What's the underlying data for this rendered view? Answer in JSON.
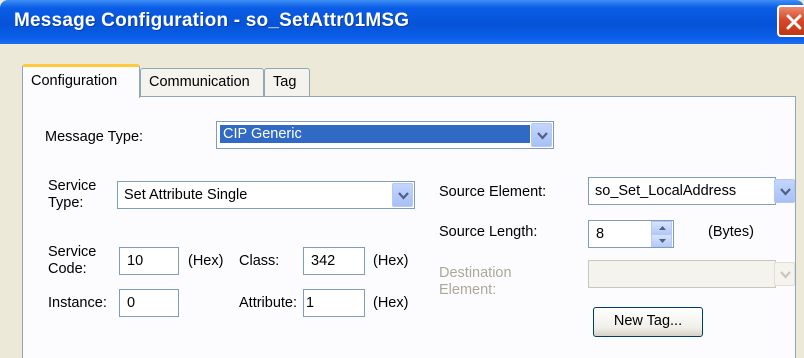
{
  "window": {
    "title": "Message Configuration - so_SetAttr01MSG"
  },
  "tabs": [
    {
      "label": "Configuration"
    },
    {
      "label": "Communication"
    },
    {
      "label": "Tag"
    }
  ],
  "form": {
    "message_type_label": "Message Type:",
    "message_type_value": "CIP Generic",
    "service_type_label_line1": "Service",
    "service_type_label_line2": "Type:",
    "service_type_value": "Set Attribute Single",
    "service_code_label_line1": "Service",
    "service_code_label_line2": "Code:",
    "service_code_value": "10",
    "hex_label": "(Hex)",
    "class_label": "Class:",
    "class_value": "342",
    "instance_label": "Instance:",
    "instance_value": "0",
    "attribute_label": "Attribute:",
    "attribute_value": "1",
    "source_element_label": "Source Element:",
    "source_element_value": "so_Set_LocalAddress",
    "source_length_label": "Source Length:",
    "source_length_value": "8",
    "bytes_label": "(Bytes)",
    "destination_label_line1": "Destination",
    "destination_label_line2": "Element:",
    "destination_value": "",
    "new_tag_label": "New Tag..."
  },
  "icons": {
    "close": "close-icon",
    "dropdown": "chevron-down-icon",
    "spin_up": "spin-up-icon",
    "spin_down": "spin-down-icon"
  },
  "colors": {
    "title_bar": "#0653d8",
    "selection": "#316ac5",
    "close_button": "#d9492a",
    "active_tab_accent": "#ffc83d"
  }
}
